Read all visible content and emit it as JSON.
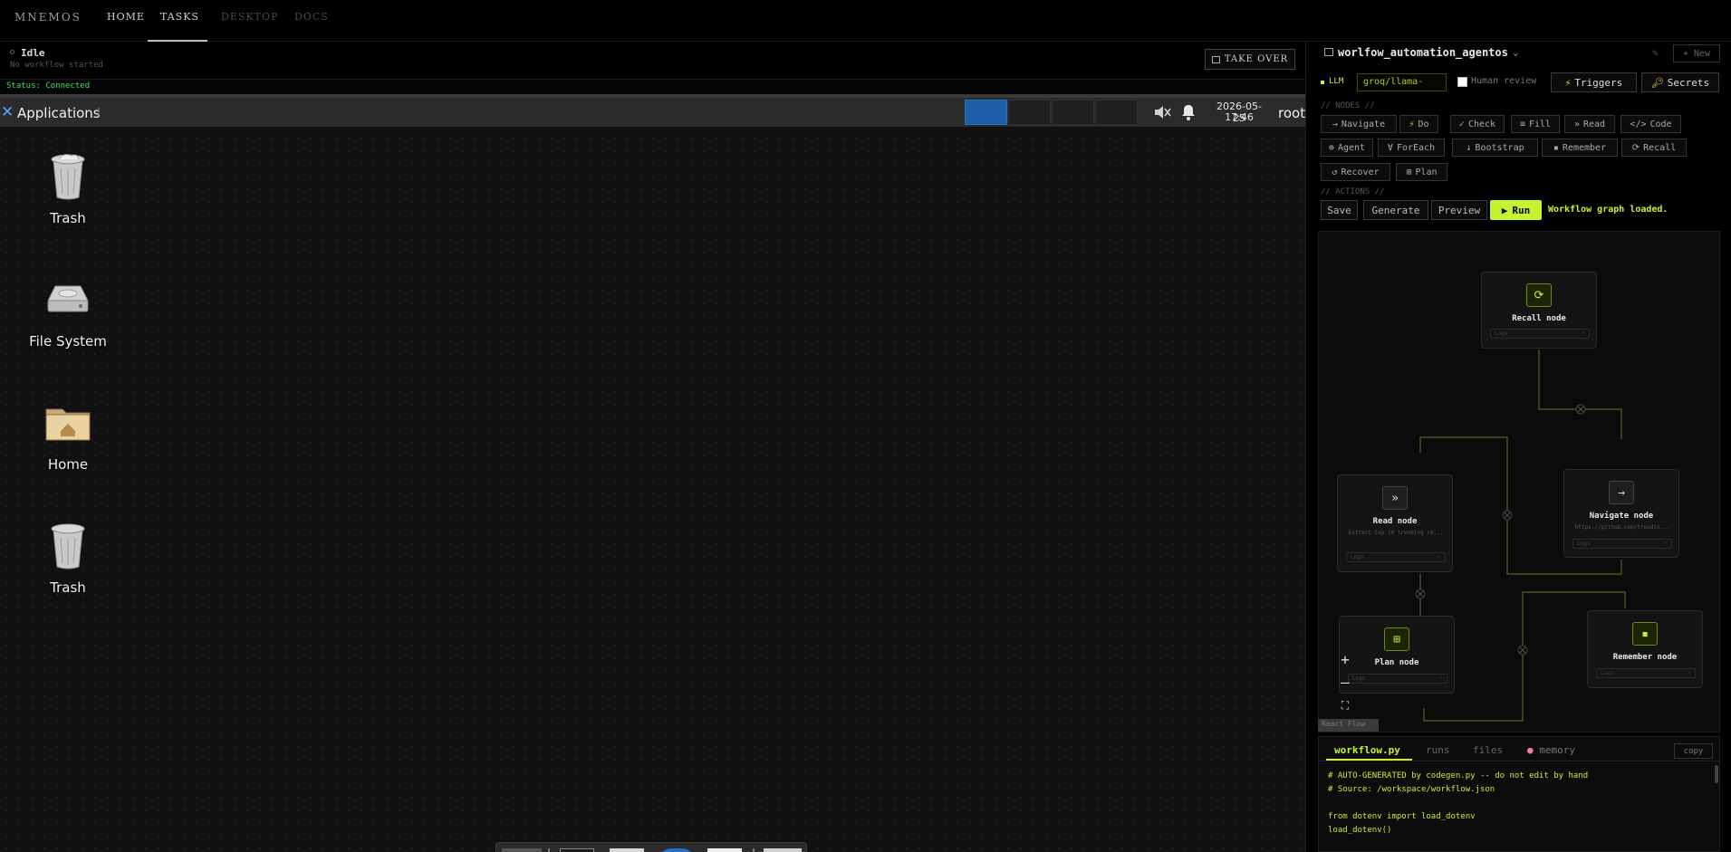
{
  "nav": {
    "brand": "MNEMOS",
    "tabs": [
      {
        "label": "HOME"
      },
      {
        "label": "TASKS"
      },
      {
        "label": "DESKTOP"
      },
      {
        "label": "DOCS"
      }
    ]
  },
  "status": {
    "state": "Idle",
    "sub": "No workflow started",
    "take_over": "TAKE OVER",
    "connection": "Status: Connected"
  },
  "desktop": {
    "panel": {
      "applications": "Applications",
      "date": "2026-05-25",
      "time": "17:46",
      "user": "root"
    },
    "icons": [
      {
        "label": "Trash",
        "icon": "trash-icon"
      },
      {
        "label": "File System",
        "icon": "drive-icon"
      },
      {
        "label": "Home",
        "icon": "home-folder-icon"
      },
      {
        "label": "Trash",
        "icon": "trash-icon"
      }
    ]
  },
  "workflow": {
    "title": "worlfow_automation_agentos",
    "new_label": "+ New",
    "llm_label": "LLM",
    "llm_value": "groq/llama-",
    "human_review": "Human review",
    "triggers": "Triggers",
    "secrets": "Secrets",
    "nodes_section": "// NODES //",
    "node_buttons": [
      {
        "icon": "→",
        "label": "Navigate"
      },
      {
        "icon": "⚡",
        "label": "Do"
      },
      {
        "icon": "✓",
        "label": "Check"
      },
      {
        "icon": "≡",
        "label": "Fill"
      },
      {
        "icon": "»",
        "label": "Read"
      },
      {
        "icon": "</>",
        "label": "Code"
      },
      {
        "icon": "⊕",
        "label": "Agent"
      },
      {
        "icon": "∀",
        "label": "ForEach"
      },
      {
        "icon": "↓",
        "label": "Bootstrap"
      },
      {
        "icon": "▪",
        "label": "Remember"
      },
      {
        "icon": "⟳",
        "label": "Recall"
      },
      {
        "icon": "↺",
        "label": "Recover"
      },
      {
        "icon": "⊞",
        "label": "Plan"
      }
    ],
    "actions_section": "// ACTIONS //",
    "actions": {
      "save": "Save",
      "generate": "Generate",
      "preview": "Preview",
      "run": "Run"
    },
    "run_status": "Workflow graph loaded."
  },
  "graph": {
    "nodes": [
      {
        "id": "recall",
        "title": "Recall node",
        "icon": "⟳",
        "sub": "",
        "logs": "Logs"
      },
      {
        "id": "read",
        "title": "Read node",
        "icon": "»",
        "sub": "Extract top 10 trending re...",
        "logs": "Logs"
      },
      {
        "id": "navigate",
        "title": "Navigate node",
        "icon": "→",
        "sub": "https://github.com/trendin...",
        "logs": "Logs"
      },
      {
        "id": "plan",
        "title": "Plan node",
        "icon": "⊞",
        "sub": "",
        "logs": "Logs"
      },
      {
        "id": "remember",
        "title": "Remember node",
        "icon": "▪",
        "sub": "",
        "logs": "Logs"
      }
    ],
    "zoom": {
      "in": "+",
      "out": "—",
      "fit": "⛶"
    },
    "flow_tag": "React Flow"
  },
  "code": {
    "tabs": [
      {
        "label": "workflow.py"
      },
      {
        "label": "runs"
      },
      {
        "label": "files"
      },
      {
        "label": "memory"
      }
    ],
    "copy": "copy",
    "lines": [
      "# AUTO-GENERATED by codegen.py -- do not edit by hand",
      "# Source: /workspace/workflow.json",
      "",
      "from dotenv import load_dotenv",
      "load_dotenv()"
    ]
  },
  "colors": {
    "accent": "#c5f231",
    "connected": "#3ee05a",
    "workspace_active": "#1e5ea8"
  }
}
